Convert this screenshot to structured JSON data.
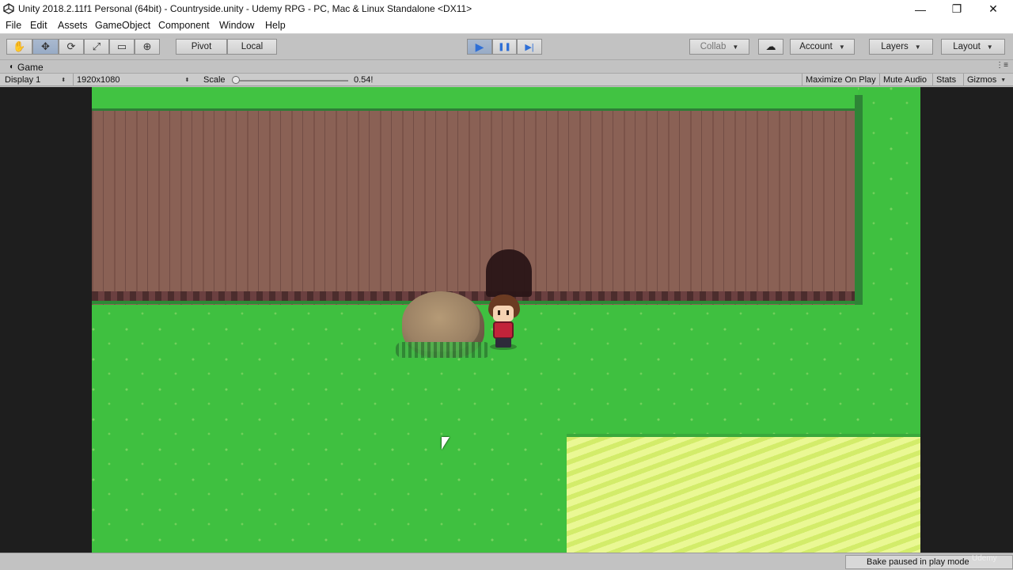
{
  "window": {
    "title": "Unity 2018.2.11f1 Personal (64bit) - Countryside.unity - Udemy RPG - PC, Mac & Linux Standalone <DX11>",
    "icon": "unity-logo-icon",
    "controls": {
      "minimize": "—",
      "restore": "❐",
      "close": "✕"
    }
  },
  "menu": {
    "items": [
      "File",
      "Edit",
      "Assets",
      "GameObject",
      "Component",
      "Window",
      "Help"
    ]
  },
  "toolbar": {
    "tools": [
      "hand-tool-icon",
      "move-tool-icon",
      "rotate-tool-icon",
      "scale-tool-icon",
      "rect-tool-icon",
      "transform-tool-icon"
    ],
    "tool_glyphs": [
      "✋",
      "✥",
      "⟳",
      "⤢",
      "▭",
      "⊕"
    ],
    "active_tool": "move-tool-icon",
    "pivot_label": "Pivot",
    "local_label": "Local",
    "play_glyph": "▶",
    "pause_glyph": "❚❚",
    "step_glyph": "▶|",
    "collab_label": "Collab",
    "cloud_glyph": "☁",
    "account_label": "Account",
    "layers_label": "Layers",
    "layout_label": "Layout"
  },
  "game_tab": {
    "title": "Game",
    "display": "Display 1",
    "resolution": "1920x1080",
    "scale_label": "Scale",
    "scale_value": "0.54!",
    "scale_fraction": 0.02,
    "maximize_on_play": "Maximize On Play",
    "mute_audio": "Mute Audio",
    "stats": "Stats",
    "gizmos": "Gizmos"
  },
  "status": {
    "message": "Bake paused in play mode",
    "watermark": "Udemy"
  },
  "colors": {
    "grass": "#3fc040",
    "cliff": "#8a6155",
    "sand": "#e6f583",
    "play_active": "#2f6fd6"
  }
}
